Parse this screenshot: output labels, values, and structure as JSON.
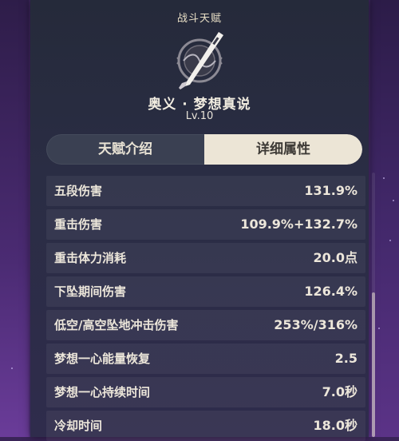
{
  "panel": {
    "section_title": "战斗天赋",
    "talent_name": "奥义 · 梦想真说",
    "talent_level": "Lv.10",
    "emblem_icon": "sword-emblem-icon"
  },
  "tabs": [
    {
      "label": "天赋介绍",
      "active": false
    },
    {
      "label": "详细属性",
      "active": true
    }
  ],
  "attributes": [
    {
      "label": "五段伤害",
      "value": "131.9%"
    },
    {
      "label": "重击伤害",
      "value": "109.9%+132.7%"
    },
    {
      "label": "重击体力消耗",
      "value": "20.0点"
    },
    {
      "label": "下坠期间伤害",
      "value": "126.4%"
    },
    {
      "label": "低空/高空坠地冲击伤害",
      "value": "253%/316%"
    },
    {
      "label": "梦想一心能量恢复",
      "value": "2.5"
    },
    {
      "label": "梦想一心持续时间",
      "value": "7.0秒"
    },
    {
      "label": "冷却时间",
      "value": "18.0秒"
    }
  ],
  "colors": {
    "panel_bg": "#2a2d44",
    "accent_cream": "#ece5d6",
    "text_light": "#ece6da",
    "background_purple": "#4a2c6e"
  }
}
